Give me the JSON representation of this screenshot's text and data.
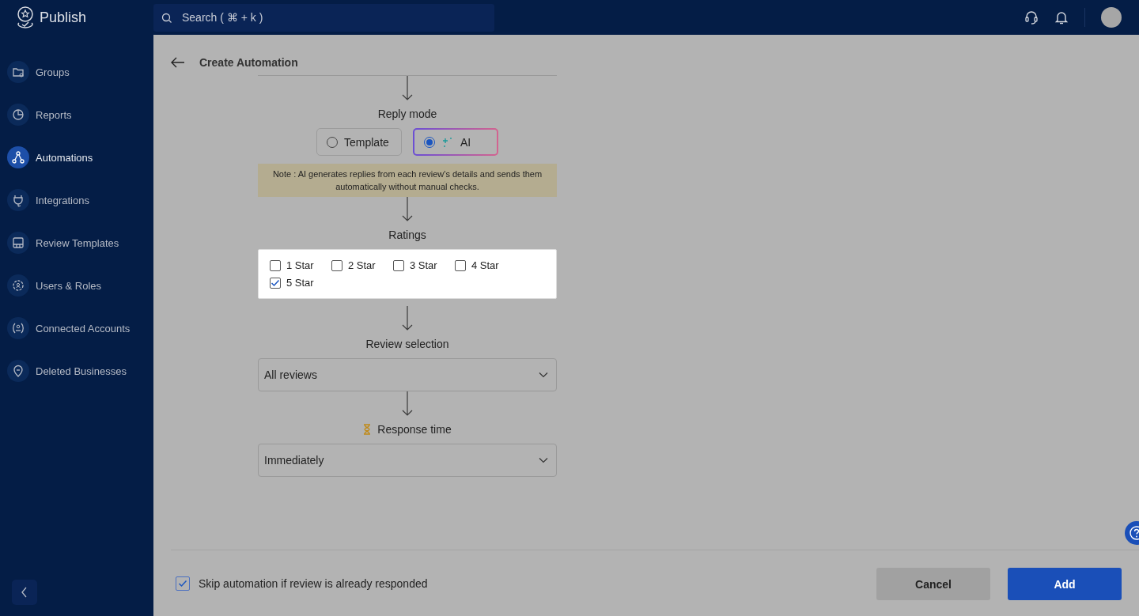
{
  "app": {
    "name": "Publish"
  },
  "search": {
    "placeholder": "Search ( ⌘ + k )"
  },
  "sidebar": {
    "items": [
      {
        "label": "Groups",
        "selected": false
      },
      {
        "label": "Reports",
        "selected": false
      },
      {
        "label": "Automations",
        "selected": true
      },
      {
        "label": "Integrations",
        "selected": false
      },
      {
        "label": "Review Templates",
        "selected": false
      },
      {
        "label": "Users & Roles",
        "selected": false
      },
      {
        "label": "Connected Accounts",
        "selected": false
      },
      {
        "label": "Deleted Businesses",
        "selected": false
      }
    ]
  },
  "page": {
    "title": "Create Automation"
  },
  "reply_mode": {
    "label": "Reply mode",
    "options": [
      {
        "label": "Template",
        "kind": "plain",
        "selected": false
      },
      {
        "label": "AI",
        "kind": "ai",
        "selected": true
      }
    ]
  },
  "note": "Note : AI generates replies from each review's details and sends them automatically without manual checks.",
  "ratings": {
    "label": "Ratings",
    "options": [
      {
        "label": "1 Star",
        "checked": false
      },
      {
        "label": "2 Star",
        "checked": false
      },
      {
        "label": "3 Star",
        "checked": false
      },
      {
        "label": "4 Star",
        "checked": false
      },
      {
        "label": "5 Star",
        "checked": true
      }
    ]
  },
  "review_selection": {
    "label": "Review selection",
    "value": "All reviews"
  },
  "response_time": {
    "label": "Response time",
    "value": "Immediately"
  },
  "footer": {
    "skip_option": {
      "label": "Skip automation if review is already responded",
      "checked": true
    },
    "buttons": [
      {
        "label": "Cancel",
        "kind": "secondary"
      },
      {
        "label": "Add",
        "kind": "primary"
      }
    ]
  }
}
